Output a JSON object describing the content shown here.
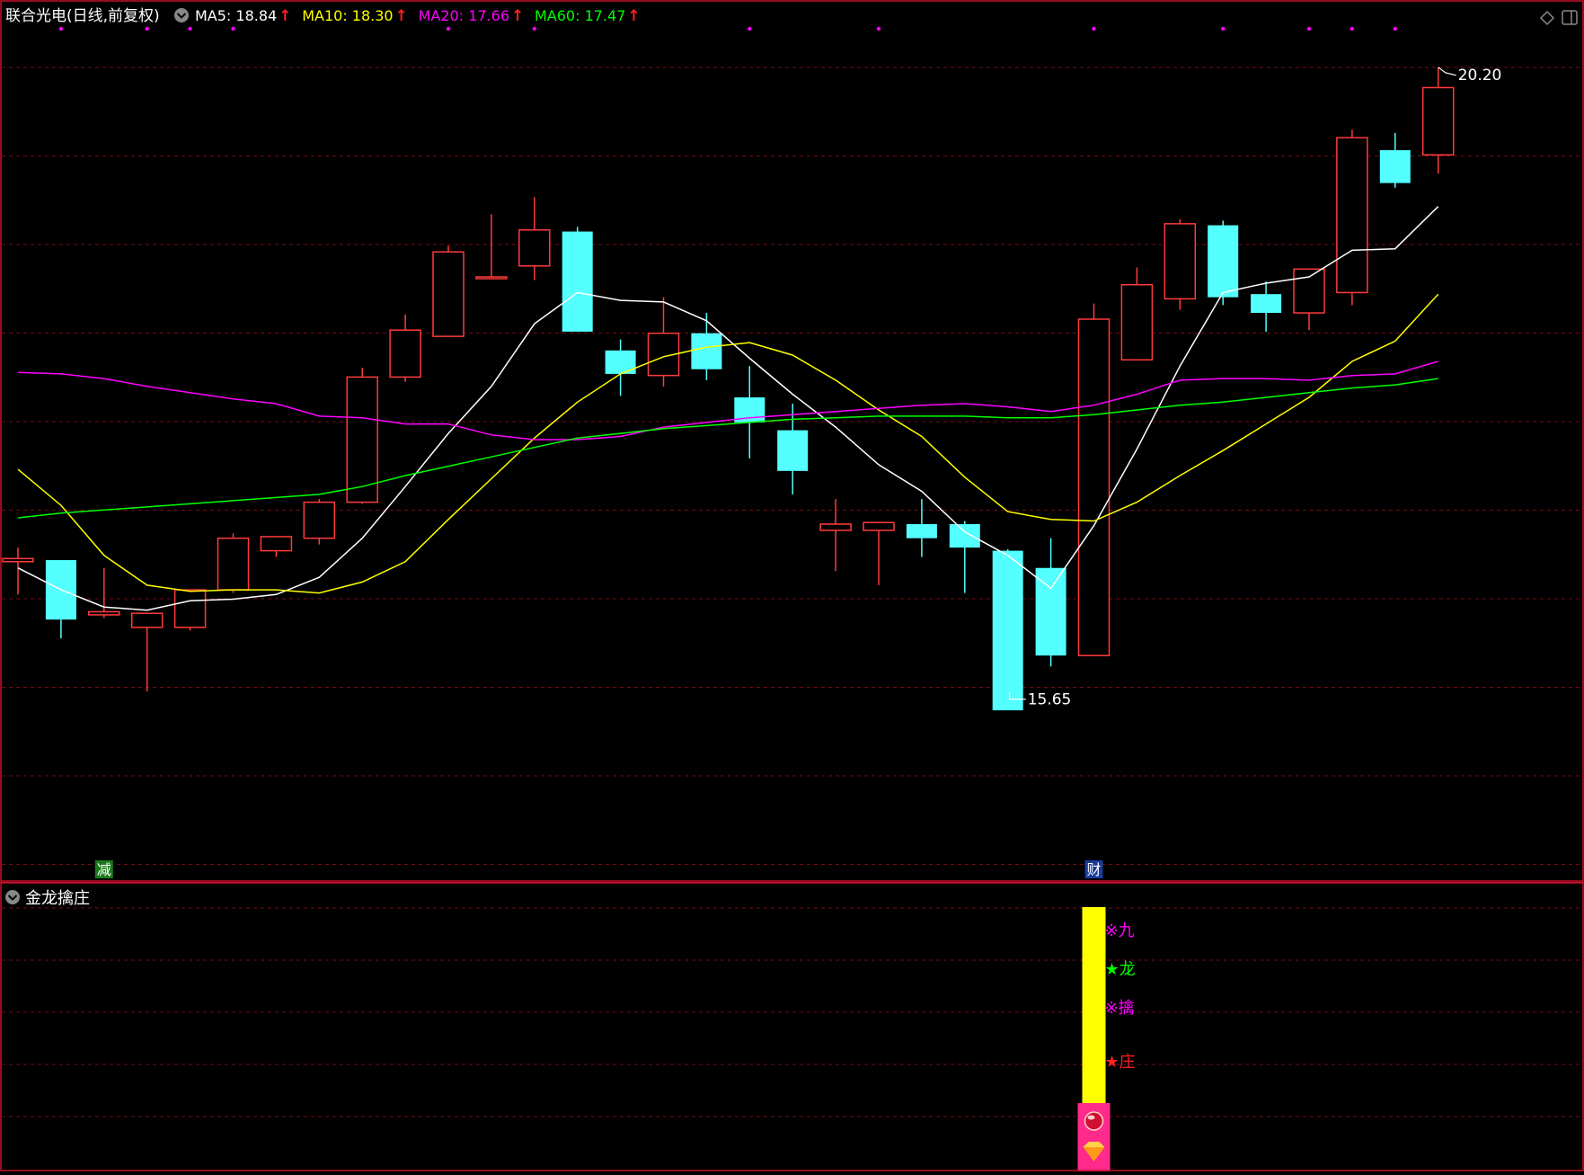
{
  "header": {
    "stock": "联合光电(日线,前复权)",
    "ma": [
      {
        "label": "MA5:",
        "value": "18.84",
        "color": "#ffffff"
      },
      {
        "label": "MA10:",
        "value": "18.30",
        "color": "#ffff00"
      },
      {
        "label": "MA20:",
        "value": "17.66",
        "color": "#ff00ff"
      },
      {
        "label": "MA60:",
        "value": "17.47",
        "color": "#00ff00"
      }
    ],
    "arrow_glyph": "↑",
    "arrow_color": "#ff2020"
  },
  "colors": {
    "up": "#ff3b3b",
    "down": "#54ffff",
    "grid": "#7a0a14",
    "axis": "#c8102e",
    "marker_dot": "#ff00ff"
  },
  "chart_data": {
    "type": "candlestick",
    "y_range": [
      15.2,
      20.4
    ],
    "candles": [
      {
        "o": 17.04,
        "h": 17.13,
        "l": 16.83,
        "c": 17.06
      },
      {
        "o": 17.05,
        "h": 17.05,
        "l": 16.55,
        "c": 16.67
      },
      {
        "o": 16.7,
        "h": 17.0,
        "l": 16.68,
        "c": 16.72
      },
      {
        "o": 16.62,
        "h": 16.7,
        "l": 16.21,
        "c": 16.71
      },
      {
        "o": 16.62,
        "h": 16.86,
        "l": 16.6,
        "c": 16.86
      },
      {
        "o": 16.86,
        "h": 17.22,
        "l": 16.84,
        "c": 17.19
      },
      {
        "o": 17.11,
        "h": 17.2,
        "l": 17.07,
        "c": 17.2
      },
      {
        "o": 17.19,
        "h": 17.44,
        "l": 17.15,
        "c": 17.42
      },
      {
        "o": 17.42,
        "h": 18.28,
        "l": 17.41,
        "c": 18.22
      },
      {
        "o": 18.22,
        "h": 18.62,
        "l": 18.19,
        "c": 18.52
      },
      {
        "o": 18.48,
        "h": 19.06,
        "l": 18.48,
        "c": 19.02
      },
      {
        "o": 18.86,
        "h": 19.26,
        "l": 18.85,
        "c": 18.86
      },
      {
        "o": 18.93,
        "h": 19.37,
        "l": 18.84,
        "c": 19.16
      },
      {
        "o": 19.15,
        "h": 19.18,
        "l": 18.51,
        "c": 18.51
      },
      {
        "o": 18.39,
        "h": 18.46,
        "l": 18.1,
        "c": 18.24
      },
      {
        "o": 18.23,
        "h": 18.73,
        "l": 18.16,
        "c": 18.5
      },
      {
        "o": 18.5,
        "h": 18.63,
        "l": 18.2,
        "c": 18.27
      },
      {
        "o": 18.09,
        "h": 18.29,
        "l": 17.7,
        "c": 17.93
      },
      {
        "o": 17.88,
        "h": 18.05,
        "l": 17.47,
        "c": 17.62
      },
      {
        "o": 17.24,
        "h": 17.44,
        "l": 16.98,
        "c": 17.28
      },
      {
        "o": 17.24,
        "h": 17.29,
        "l": 16.89,
        "c": 17.29
      },
      {
        "o": 17.28,
        "h": 17.44,
        "l": 17.07,
        "c": 17.19
      },
      {
        "o": 17.28,
        "h": 17.3,
        "l": 16.84,
        "c": 17.13
      },
      {
        "o": 17.11,
        "h": 17.12,
        "l": 16.23,
        "c": 16.09
      },
      {
        "o": 17.0,
        "h": 17.19,
        "l": 16.37,
        "c": 16.44
      },
      {
        "o": 16.44,
        "h": 18.69,
        "l": 16.44,
        "c": 18.59
      },
      {
        "o": 18.33,
        "h": 18.92,
        "l": 18.33,
        "c": 18.81
      },
      {
        "o": 18.72,
        "h": 19.23,
        "l": 18.65,
        "c": 19.2
      },
      {
        "o": 19.19,
        "h": 19.22,
        "l": 18.68,
        "c": 18.73
      },
      {
        "o": 18.75,
        "h": 18.83,
        "l": 18.51,
        "c": 18.63
      },
      {
        "o": 18.63,
        "h": 18.91,
        "l": 18.52,
        "c": 18.91
      },
      {
        "o": 18.76,
        "h": 19.8,
        "l": 18.68,
        "c": 19.75
      },
      {
        "o": 19.67,
        "h": 19.78,
        "l": 19.43,
        "c": 19.46
      },
      {
        "o": 19.64,
        "h": 20.2,
        "l": 19.52,
        "c": 20.07
      }
    ],
    "ma_series": [
      {
        "name": "MA5",
        "color": "#ffffff",
        "values": [
          17.0,
          16.86,
          16.75,
          16.73,
          16.79,
          16.8,
          16.83,
          16.94,
          17.19,
          17.52,
          17.86,
          18.16,
          18.56,
          18.76,
          18.71,
          18.7,
          18.58,
          18.34,
          18.11,
          17.9,
          17.66,
          17.49,
          17.23,
          17.08,
          16.87,
          17.27,
          17.76,
          18.29,
          18.76,
          18.82,
          18.86,
          19.03,
          19.04,
          19.31
        ]
      },
      {
        "name": "MA10",
        "color": "#ffff00",
        "values": [
          17.63,
          17.4,
          17.08,
          16.89,
          16.85,
          16.86,
          16.86,
          16.84,
          16.91,
          17.04,
          17.31,
          17.57,
          17.83,
          18.06,
          18.24,
          18.35,
          18.41,
          18.44,
          18.36,
          18.2,
          18.01,
          17.84,
          17.58,
          17.36,
          17.31,
          17.3,
          17.42,
          17.59,
          17.75,
          17.92,
          18.09,
          18.32,
          18.45,
          18.75
        ]
      },
      {
        "name": "MA20",
        "color": "#ff00ff",
        "values": [
          18.25,
          18.24,
          18.21,
          18.16,
          18.12,
          18.08,
          18.05,
          17.97,
          17.96,
          17.92,
          17.92,
          17.85,
          17.82,
          17.82,
          17.84,
          17.9,
          17.93,
          17.96,
          17.98,
          18.0,
          18.02,
          18.04,
          18.05,
          18.03,
          18.0,
          18.04,
          18.11,
          18.2,
          18.21,
          18.21,
          18.2,
          18.23,
          18.24,
          18.32
        ]
      },
      {
        "name": "MA60",
        "color": "#00ff00",
        "values": [
          17.32,
          17.35,
          17.37,
          17.39,
          17.41,
          17.43,
          17.45,
          17.47,
          17.52,
          17.59,
          17.65,
          17.71,
          17.77,
          17.83,
          17.86,
          17.89,
          17.91,
          17.93,
          17.95,
          17.96,
          17.97,
          17.97,
          17.97,
          17.96,
          17.96,
          17.98,
          18.01,
          18.04,
          18.06,
          18.09,
          18.12,
          18.15,
          18.17,
          18.21
        ]
      }
    ],
    "high_label": "20.20",
    "low_label": "15.65",
    "high_index": 33,
    "low_index": 23,
    "top_dot_indexes": [
      1,
      3,
      4,
      5,
      10,
      12,
      17,
      20,
      25,
      28,
      30,
      31,
      32
    ],
    "event_tags": [
      {
        "index": 2,
        "text": "减",
        "bg": "#1a7a1a",
        "color": "#ffffff"
      },
      {
        "index": 25,
        "text": "财",
        "bg": "#1a3a9a",
        "color": "#ffffff"
      }
    ]
  },
  "indicator": {
    "title": "金龙擒庄",
    "bar_index": 25,
    "labels": [
      {
        "symbol": "※",
        "text": "九",
        "color": "#ff00ff"
      },
      {
        "symbol": "★",
        "text": "龙",
        "color": "#00ff00"
      },
      {
        "symbol": "※",
        "text": "擒",
        "color": "#ff00ff"
      },
      {
        "symbol": "★",
        "text": "庄",
        "color": "#ff2020"
      }
    ],
    "bar_color": "#ffff00",
    "block_color": "#ff2a8a"
  }
}
